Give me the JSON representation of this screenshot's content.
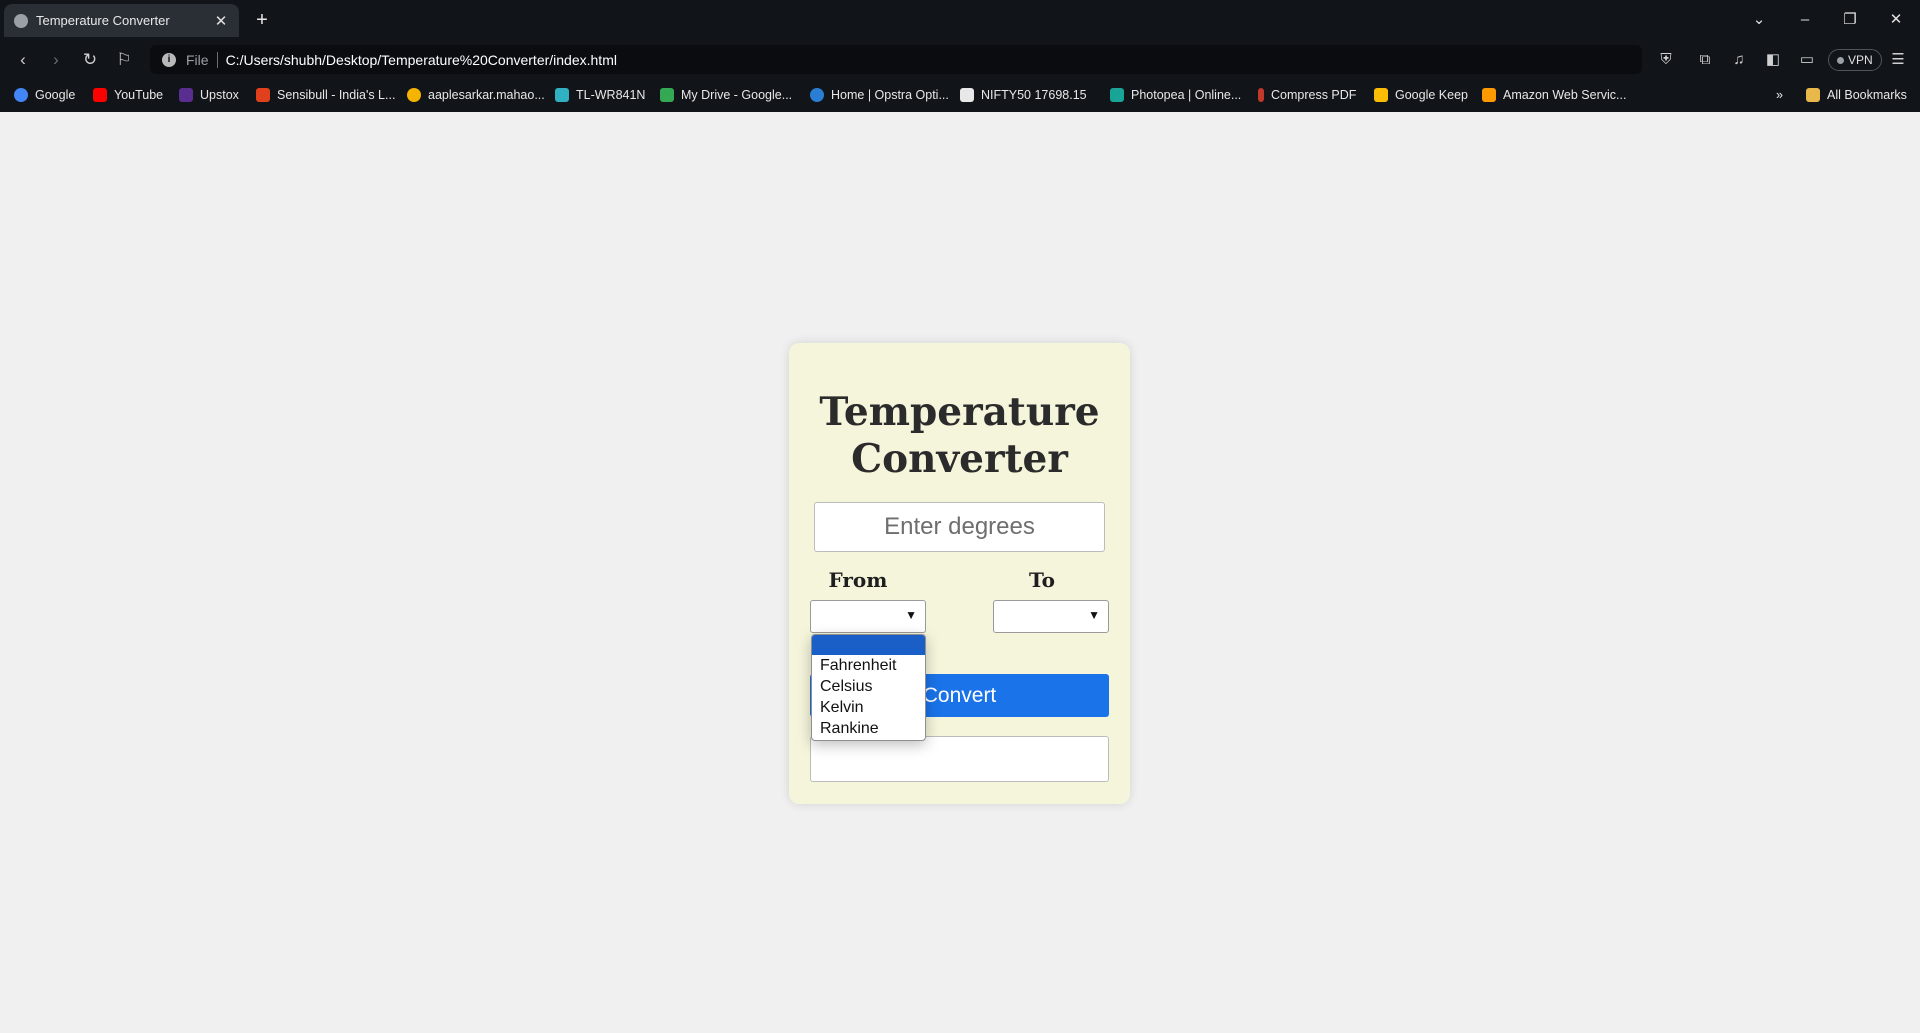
{
  "browser": {
    "tab_title": "Temperature Converter",
    "tab_close": "✕",
    "new_tab": "+",
    "url_scheme": "File",
    "url": "C:/Users/shubh/Desktop/Temperature%20Converter/index.html",
    "vpn_label": "VPN"
  },
  "bookmarks": [
    {
      "label": "Google",
      "color": "#4285f4"
    },
    {
      "label": "YouTube",
      "color": "#ff0000"
    },
    {
      "label": "Upstox",
      "color": "#5a2d91"
    },
    {
      "label": "Sensibull - India's L...",
      "color": "#e0401c"
    },
    {
      "label": "aaplesarkar.mahao...",
      "color": "#f4b400"
    },
    {
      "label": "TL-WR841N",
      "color": "#30b0c0"
    },
    {
      "label": "My Drive - Google...",
      "color": "#34a853"
    },
    {
      "label": "Home | Opstra Opti...",
      "color": "#2a7fd4"
    },
    {
      "label": "NIFTY50   17698.15",
      "color": "#e8e8e8"
    },
    {
      "label": "Photopea | Online...",
      "color": "#18a497"
    },
    {
      "label": "Compress PDF",
      "color": "#c0392b"
    },
    {
      "label": "Google Keep",
      "color": "#fbbc04"
    },
    {
      "label": "Amazon Web Servic...",
      "color": "#ff9900"
    }
  ],
  "all_bookmarks": "All Bookmarks",
  "app": {
    "title": "Temperature Converter",
    "input_placeholder": "Enter degrees",
    "from_label": "From",
    "to_label": "To",
    "convert_label": "Convert",
    "from_options": [
      "",
      "Fahrenheit",
      "Celsius",
      "Kelvin",
      "Rankine"
    ]
  },
  "colors": {
    "card_bg": "#f5f5dc",
    "accent": "#1a73e8",
    "page_bg": "#f0f0f0"
  }
}
